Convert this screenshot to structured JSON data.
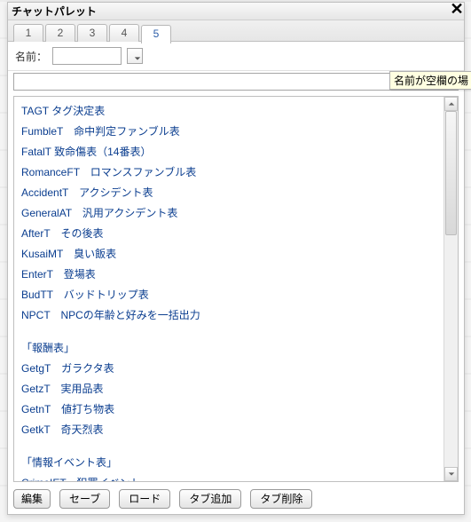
{
  "window": {
    "title": "チャットパレット",
    "close": "✕"
  },
  "tabs": [
    {
      "label": "1"
    },
    {
      "label": "2"
    },
    {
      "label": "3"
    },
    {
      "label": "4"
    },
    {
      "label": "5",
      "active": true
    }
  ],
  "name_row": {
    "label": "名前：",
    "value": ""
  },
  "command_input": {
    "value": ""
  },
  "tooltip": "名前が空欄の場",
  "palette": [
    {
      "t": "row",
      "text": "TAGT タグ決定表"
    },
    {
      "t": "row",
      "text": "FumbleT　命中判定ファンブル表"
    },
    {
      "t": "row",
      "text": "FatalT 致命傷表（14番表）"
    },
    {
      "t": "row",
      "text": "RomanceFT　ロマンスファンブル表"
    },
    {
      "t": "row",
      "text": "AccidentT　アクシデント表"
    },
    {
      "t": "row",
      "text": "GeneralAT　汎用アクシデント表"
    },
    {
      "t": "row",
      "text": "AfterT　その後表"
    },
    {
      "t": "row",
      "text": "KusaiMT　臭い飯表"
    },
    {
      "t": "row",
      "text": "EnterT　登場表"
    },
    {
      "t": "row",
      "text": "BudTT　バッドトリップ表"
    },
    {
      "t": "row",
      "text": "NPCT　NPCの年齢と好みを一括出力"
    },
    {
      "t": "blank"
    },
    {
      "t": "row",
      "text": "「報酬表」"
    },
    {
      "t": "row",
      "text": "GetgT　ガラクタ表"
    },
    {
      "t": "row",
      "text": "GetzT　実用品表"
    },
    {
      "t": "row",
      "text": "GetnT　値打ち物表"
    },
    {
      "t": "row",
      "text": "GetkT　奇天烈表"
    },
    {
      "t": "blank"
    },
    {
      "t": "row",
      "text": "「情報イベント表」"
    },
    {
      "t": "row",
      "text": "CrimeIET　犯罪イベント"
    }
  ],
  "footer_buttons": {
    "edit": "編集",
    "save": "セーブ",
    "load": "ロード",
    "addtab": "タブ追加",
    "deltab": "タブ削除"
  }
}
